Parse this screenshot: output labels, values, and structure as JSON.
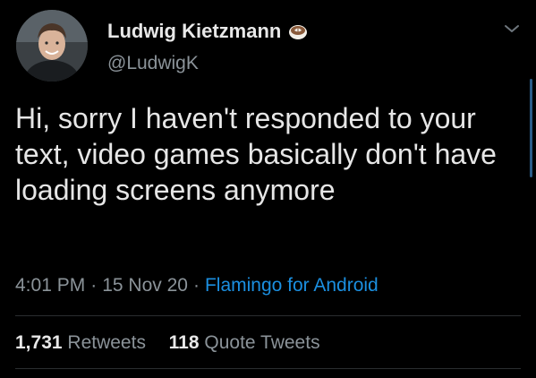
{
  "author": {
    "display_name": "Ludwig Kietzmann",
    "handle": "@LudwigK",
    "avatar_icon": "profile-photo",
    "badge_icon": "latte-coffee-emoji"
  },
  "tweet": {
    "text": "Hi, sorry I haven't responded to your text, video games basically don't have loading screens anymore",
    "time": "4:01 PM",
    "separator": "·",
    "date": "15 Nov 20",
    "source": "Flamingo for Android"
  },
  "stats": {
    "retweets_count": "1,731",
    "retweets_label": "Retweets",
    "quote_count": "118",
    "quote_label": "Quote Tweets"
  },
  "colors": {
    "background": "#000000",
    "link": "#1b8fe0",
    "secondary_text": "#8b9399",
    "primary_text": "#e6e6e6"
  },
  "menu_icon": "chevron-down-icon"
}
